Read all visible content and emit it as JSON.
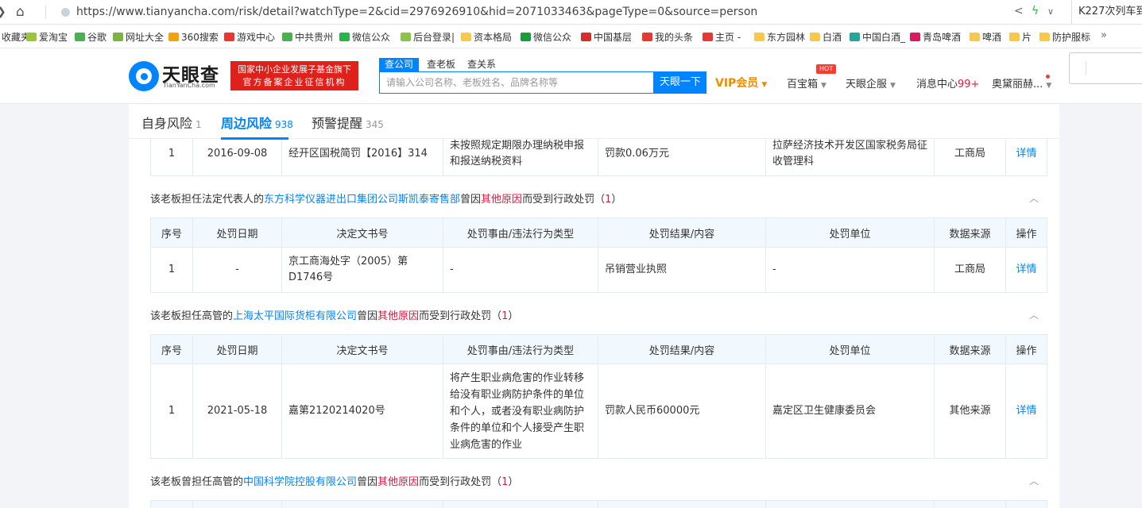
{
  "browser": {
    "url": "https://www.tianyancha.com/risk/detail?watchType=2&cid=2976926910&hid=2071033463&pageType=0&source=person",
    "right_text": "K227次列车到",
    "bookmarks": [
      {
        "label": "收藏夹",
        "icon": "star-icon",
        "color": "#f2b705"
      },
      {
        "label": "爱淘宝",
        "icon": "leaf-icon",
        "color": "#9bc53d"
      },
      {
        "label": "谷歌",
        "icon": "google-icon",
        "color": "#4caf50"
      },
      {
        "label": "网址大全",
        "icon": "compass-icon",
        "color": "#7cb342"
      },
      {
        "label": "360搜索",
        "icon": "search-icon",
        "color": "#f0a30a"
      },
      {
        "label": "游戏中心",
        "icon": "gamepad-icon",
        "color": "#e53935"
      },
      {
        "label": "中共贵州",
        "icon": "site-icon",
        "color": "#4caf50"
      },
      {
        "label": "微信公众",
        "icon": "wechat-icon",
        "color": "#2ab34a"
      },
      {
        "label": "后台登录|",
        "icon": "leaf-icon",
        "color": "#8bc34a"
      },
      {
        "label": "资本格局",
        "icon": "folder-icon",
        "color": "#f7c948"
      },
      {
        "label": "微信公众",
        "icon": "site-96-icon",
        "color": "#1a9b3c"
      },
      {
        "label": "中国基层",
        "icon": "news-icon",
        "color": "#d32f2f"
      },
      {
        "label": "我的头条",
        "icon": "news-icon",
        "color": "#e53935"
      },
      {
        "label": "主页 -",
        "icon": "news-icon",
        "color": "#e53935"
      },
      {
        "label": "东方园林",
        "icon": "folder-icon",
        "color": "#f7c948"
      },
      {
        "label": "白酒",
        "icon": "folder-icon",
        "color": "#f7c948"
      },
      {
        "label": "中国白酒_",
        "icon": "site-icon",
        "color": "#26a69a"
      },
      {
        "label": "青岛啤酒",
        "icon": "beer-icon",
        "color": "#d81b60"
      },
      {
        "label": "啤酒",
        "icon": "folder-icon",
        "color": "#f7c948"
      },
      {
        "label": "片",
        "icon": "folder-icon",
        "color": "#f7c948"
      },
      {
        "label": "防护服标",
        "icon": "folder-icon",
        "color": "#f7c948"
      }
    ],
    "more": "»"
  },
  "header": {
    "logo_cn": "天眼查",
    "logo_en": "TianYanCha.com",
    "slogan_line1": "国家中小企业发展子基金旗下",
    "slogan_line2": "官方备案企业征信机构",
    "search_tabs": [
      "查公司",
      "查老板",
      "查关系"
    ],
    "search_placeholder": "请输入公司名称、老板姓名、品牌名称等",
    "search_button": "天眼一下",
    "nav": {
      "vip": "VIP会员",
      "treasure": "百宝箱",
      "hot": "HOT",
      "enterprise": "天眼企服",
      "messages": "消息中心",
      "messages_count": "99+",
      "user": "奥黛丽赫..."
    }
  },
  "tabs": [
    {
      "label": "自身风险",
      "count": "1"
    },
    {
      "label": "周边风险",
      "count": "938"
    },
    {
      "label": "预警提醒",
      "count": "345"
    }
  ],
  "columns": [
    "序号",
    "处罚日期",
    "决定文书号",
    "处罚事由/违法行为类型",
    "处罚结果/内容",
    "处罚单位",
    "数据来源",
    "操作"
  ],
  "top_row": {
    "seq": "1",
    "date": "2016-09-08",
    "doc": "经开区国税简罚【2016】314",
    "reason": "未按照规定期限办理纳税申报和报送纳税资料",
    "result": "罚款0.06万元",
    "unit": "拉萨经济技术开发区国家税务局征收管理科",
    "source": "工商局",
    "action": "详情"
  },
  "sections": [
    {
      "prefix": "该老板担任法定代表人的",
      "company": "东方科学仪器进出口集团公司斯凯泰寄售部",
      "mid": "曾因",
      "reason": "其他原因",
      "suffix": "而受到行政处罚（",
      "count": "1",
      "close": "）",
      "rows": [
        {
          "seq": "1",
          "date": "-",
          "doc": "京工商海处字（2005）第D1746号",
          "reason": "-",
          "result": "吊销营业执照",
          "unit": "-",
          "source": "工商局",
          "action": "详情"
        }
      ]
    },
    {
      "prefix": "该老板担任高管的",
      "company": "上海太平国际货柜有限公司",
      "mid": "曾因",
      "reason": "其他原因",
      "suffix": "而受到行政处罚（",
      "count": "1",
      "close": "）",
      "rows": [
        {
          "seq": "1",
          "date": "2021-05-18",
          "doc": "嘉第2120214020号",
          "reason": "将产生职业病危害的作业转移给没有职业病防护条件的单位和个人，或者没有职业病防护条件的单位和个人接受产生职业病危害的作业",
          "result": "罚款人民币60000元",
          "unit": "嘉定区卫生健康委员会",
          "source": "其他来源",
          "action": "详情"
        }
      ]
    },
    {
      "prefix": "该老板曾担任高管的",
      "company": "中国科学院控股有限公司",
      "mid": "曾因",
      "reason": "其他原因",
      "suffix": "而受到行政处罚（",
      "count": "1",
      "close": "）",
      "rows": []
    }
  ]
}
